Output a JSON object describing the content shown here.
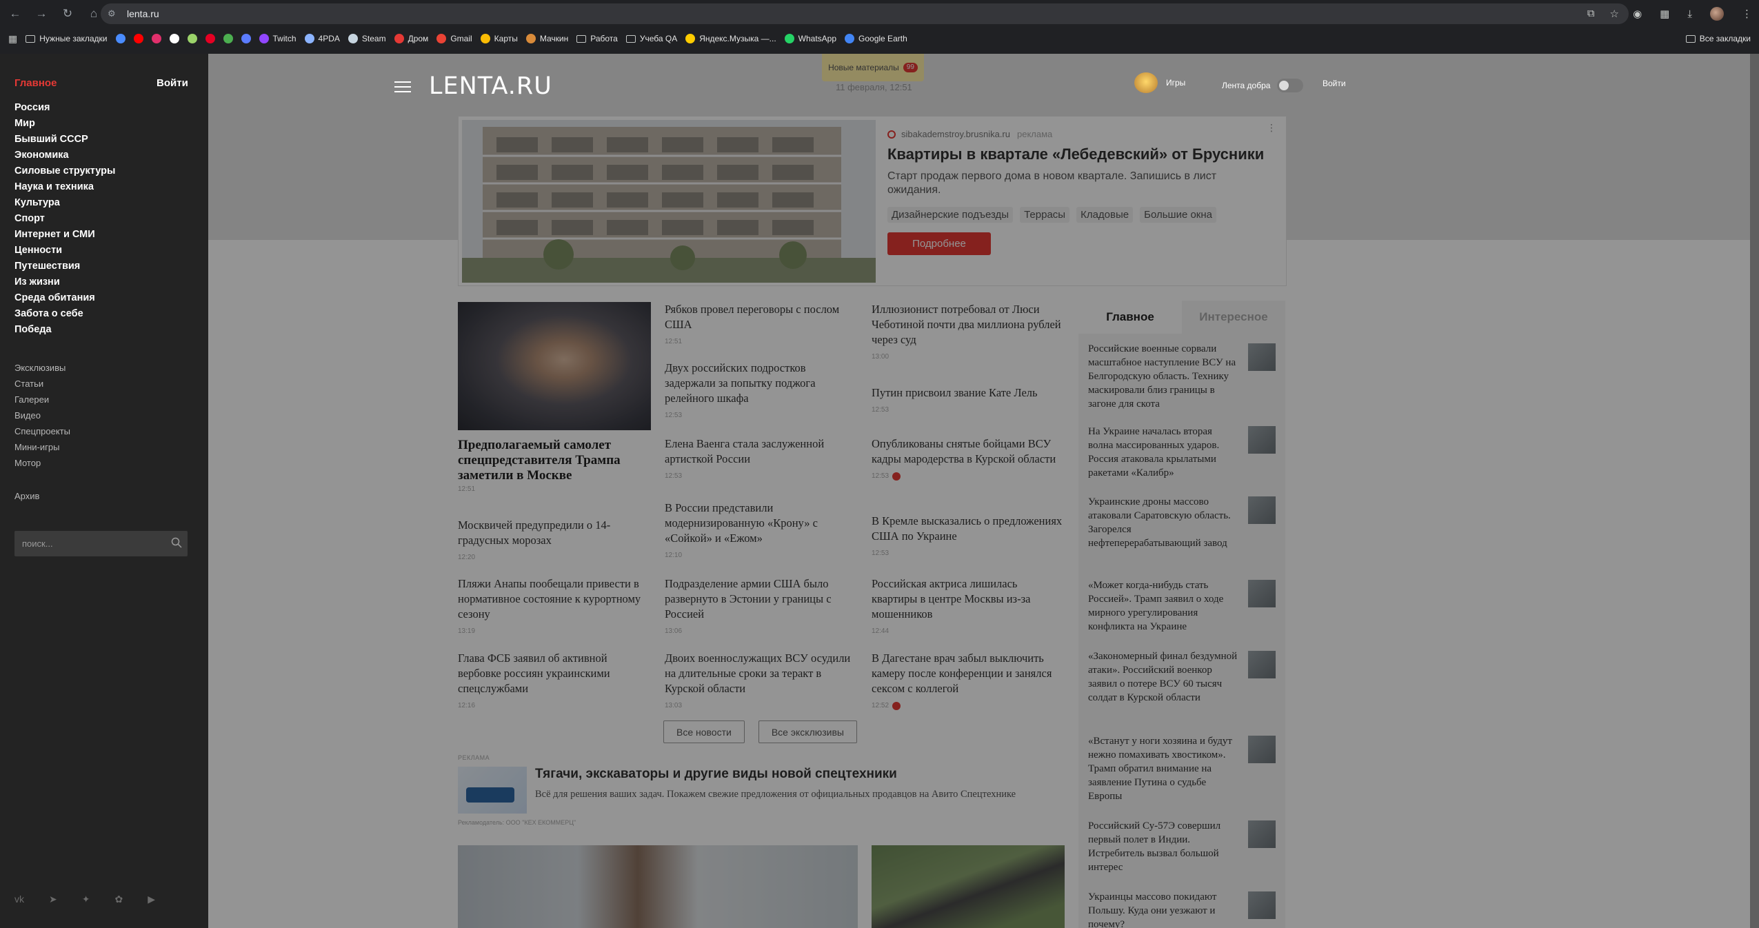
{
  "browser": {
    "url": "lenta.ru",
    "bookmarks": [
      {
        "label": "Нужные закладки",
        "type": "folder"
      },
      {
        "label": "",
        "icon": "messenger-icon",
        "color": "#4a8cff"
      },
      {
        "label": "",
        "icon": "youtube-icon",
        "color": "#ff0000"
      },
      {
        "label": "",
        "icon": "instagram-icon",
        "color": "#e1306c"
      },
      {
        "label": "",
        "icon": "grammarly-icon",
        "color": "#ffffff"
      },
      {
        "label": "",
        "icon": "green-app-icon",
        "color": "#9bd36a"
      },
      {
        "label": "",
        "icon": "pinterest-icon",
        "color": "#e60023"
      },
      {
        "label": "",
        "icon": "map-app-icon",
        "color": "#4caf50"
      },
      {
        "label": "",
        "icon": "vk-video-icon",
        "color": "#5b7cff"
      },
      {
        "label": "Twitch",
        "icon": "twitch-icon",
        "color": "#9146ff"
      },
      {
        "label": "4PDA",
        "icon": "4pda-icon",
        "color": "#8cb4ff"
      },
      {
        "label": "Steam",
        "icon": "steam-icon",
        "color": "#c7d5e0"
      },
      {
        "label": "Дром",
        "icon": "drom-icon",
        "color": "#e53935"
      },
      {
        "label": "Gmail",
        "icon": "gmail-icon",
        "color": "#ea4335"
      },
      {
        "label": "Карты",
        "icon": "maps-icon",
        "color": "#fbbc04"
      },
      {
        "label": "Мачкин",
        "icon": "machkin-icon",
        "color": "#d98b3a"
      },
      {
        "label": "Работа",
        "type": "folder"
      },
      {
        "label": "Учеба QA",
        "type": "folder"
      },
      {
        "label": "Яндекс.Музыка —...",
        "icon": "yandex-music-icon",
        "color": "#ffcc00"
      },
      {
        "label": "WhatsApp",
        "icon": "whatsapp-icon",
        "color": "#25d366"
      },
      {
        "label": "Google Earth",
        "icon": "google-earth-icon",
        "color": "#4285f4"
      }
    ],
    "all_bookmarks": "Все закладки"
  },
  "sidebar": {
    "main": "Главное",
    "login": "Войти",
    "rubrics": [
      "Россия",
      "Мир",
      "Бывший СССР",
      "Экономика",
      "Силовые структуры",
      "Наука и техника",
      "Культура",
      "Спорт",
      "Интернет и СМИ",
      "Ценности",
      "Путешествия",
      "Из жизни",
      "Среда обитания",
      "Забота о себе",
      "Победа"
    ],
    "secondary": [
      "Эксклюзивы",
      "Статьи",
      "Галереи",
      "Видео",
      "Спецпроекты",
      "Мини-игры",
      "Мотор"
    ],
    "archive": "Архив",
    "search_placeholder": "поиск..."
  },
  "header": {
    "logo": "LENTA.RU",
    "new_materials": "Новые материалы",
    "new_count": "99",
    "date": "11 февраля, 12:51",
    "games": "Игры",
    "good_feed": "Лента добра",
    "login": "Войти"
  },
  "ad": {
    "source": "sibakademstroy.brusnika.ru",
    "label": "реклама",
    "title": "Квартиры в квартале «Лебедевский» от Брусники",
    "description": "Старт продаж первого дома в новом квартале. Запишись в лист ожидания.",
    "tags": [
      "Дизайнерские подъезды",
      "Террасы",
      "Кладовые",
      "Большие окна"
    ],
    "button": "Подробнее"
  },
  "top_news": {
    "title": "Предполагаемый самолет спецпредставителя Трампа заметили в Москве",
    "time": "12:51"
  },
  "news_col1": [
    {
      "title": "Москвичей предупредили о 14-градусных морозах",
      "time": "12:20"
    },
    {
      "title": "Пляжи Анапы пообещали привести в нормативное состояние к курортному сезону",
      "time": "13:19"
    },
    {
      "title": "Глава ФСБ заявил об активной вербовке россиян украинскими спецслужбами",
      "time": "12:16"
    }
  ],
  "news_col2": [
    {
      "title": "Рябков провел переговоры с послом США",
      "time": "12:51"
    },
    {
      "title": "Двух российских подростков задержали за попытку поджога релейного шкафа",
      "time": "12:53"
    },
    {
      "title": "Елена Ваенга стала заслуженной артисткой России",
      "time": "12:53"
    },
    {
      "title": "В России представили модернизированную «Крону» с «Сойкой» и «Ежом»",
      "time": "12:10"
    },
    {
      "title": "Подразделение армии США было развернуто в Эстонии у границы с Россией",
      "time": "13:06"
    },
    {
      "title": "Двоих военнослужащих ВСУ осудили на длительные сроки за теракт в Курской области",
      "time": "13:03"
    }
  ],
  "news_col3": [
    {
      "title": "Иллюзионист потребовал от Люси Чеботиной почти два миллиона рублей через суд",
      "time": "13:00",
      "video": false
    },
    {
      "title": "Путин присвоил звание Кате Лель",
      "time": "12:53",
      "video": false
    },
    {
      "title": "Опубликованы снятые бойцами ВСУ кадры мародерства в Курской области",
      "time": "12:53",
      "video": true
    },
    {
      "title": "В Кремле высказались о предложениях США по Украине",
      "time": "12:53",
      "video": false
    },
    {
      "title": "Российская актриса лишилась квартиры в центре Москвы из-за мошенников",
      "time": "12:44",
      "video": false
    },
    {
      "title": "В Дагестане врач забыл выключить камеру после конференции и занялся сексом с коллегой",
      "time": "12:52",
      "video": true
    }
  ],
  "buttons": {
    "all_news": "Все новости",
    "all_exclusives": "Все эксклюзивы"
  },
  "ad2": {
    "label": "РЕКЛАМА",
    "title": "Тягачи, экскаваторы и другие виды новой спецтехники",
    "description": "Всё для решения ваших задач. Покажем свежие предложения от официальных продавцов на Авито Спецтехнике",
    "advertiser": "Рекламодатель: ООО \"КЕХ ЕКОММЕРЦ\""
  },
  "right_column": {
    "tabs": [
      "Главное",
      "Интересное"
    ],
    "items": [
      "Российские военные сорвали масштабное наступление ВСУ на Белгородскую область. Технику маскировали близ границы в загоне для скота",
      "На Украине началась вторая волна массированных ударов. Россия атаковала крылатыми ракетами «Калибр»",
      "Украинские дроны массово атаковали Саратовскую область. Загорелся нефтеперерабатывающий завод",
      "«Может когда-нибудь стать Россией». Трамп заявил о ходе мирного урегулирования конфликта на Украине",
      "«Закономерный финал бездумной атаки». Российский военкор заявил о потере ВСУ 60 тысяч солдат в Курской области",
      "«Встанут у ноги хозяина и будут нежно помахивать хвостиком». Трамп обратил внимание на заявление Путина о судьбе Европы",
      "Российский Су-57Э совершил первый полет в Индии. Истребитель вызвал большой интерес",
      "Украинцы массово покидают Польшу. Куда они уезжают и почему?"
    ]
  },
  "colors": {
    "accent": "#e53935",
    "sidebar_bg": "#232323",
    "chrome_bg": "#202124"
  }
}
